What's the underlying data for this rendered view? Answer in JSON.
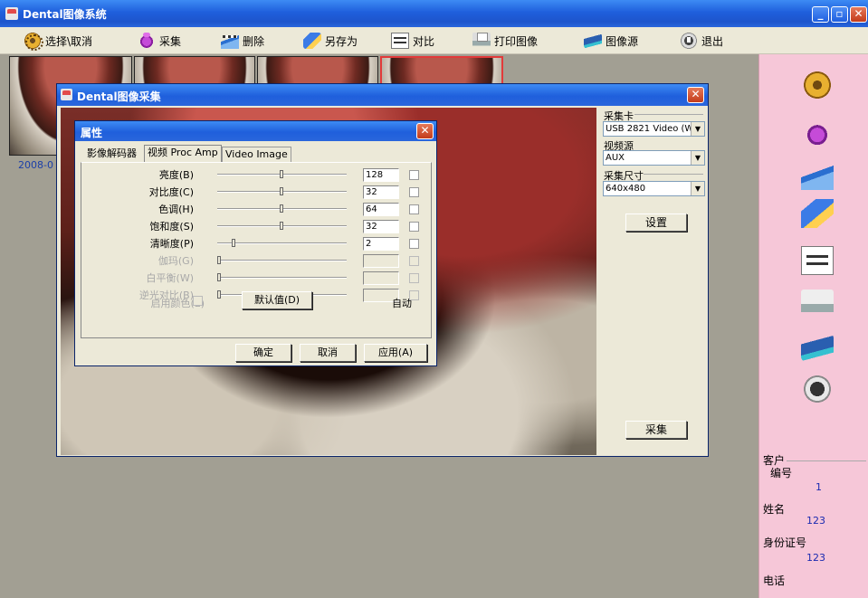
{
  "window": {
    "title": "Dental图像系统"
  },
  "toolbar": {
    "items": [
      {
        "label": "选择\\取消",
        "icon": "film-reel-icon"
      },
      {
        "label": "采集",
        "icon": "capture-icon"
      },
      {
        "label": "删除",
        "icon": "clapper-icon"
      },
      {
        "label": "另存为",
        "icon": "save-disk-icon"
      },
      {
        "label": "对比",
        "icon": "compare-icon"
      },
      {
        "label": "打印图像",
        "icon": "printer-icon"
      },
      {
        "label": "图像源",
        "icon": "scanner-icon"
      },
      {
        "label": "退出",
        "icon": "exit-icon"
      }
    ]
  },
  "thumbnails": {
    "date_label": "2008-0"
  },
  "capture_dialog": {
    "title": "Dental图像采集",
    "card_label": "采集卡",
    "card_value": "USB 2821 Video (W",
    "source_label": "视频源",
    "source_value": "AUX",
    "size_label": "采集尺寸",
    "size_value": "640x480",
    "settings_button": "设置",
    "capture_button": "采集"
  },
  "properties_dialog": {
    "title": "属性",
    "tabs": [
      "影像解码器",
      "视频 Proc Amp",
      "Video Image"
    ],
    "rows": [
      {
        "label": "亮度(B)",
        "value": "128",
        "enabled": true,
        "pos": 0.5
      },
      {
        "label": "对比度(C)",
        "value": "32",
        "enabled": true,
        "pos": 0.5
      },
      {
        "label": "色调(H)",
        "value": "64",
        "enabled": true,
        "pos": 0.5
      },
      {
        "label": "饱和度(S)",
        "value": "32",
        "enabled": true,
        "pos": 0.5
      },
      {
        "label": "清晰度(P)",
        "value": "2",
        "enabled": true,
        "pos": 0.12
      },
      {
        "label": "伽玛(G)",
        "value": "",
        "enabled": false,
        "pos": 0.0
      },
      {
        "label": "白平衡(W)",
        "value": "",
        "enabled": false,
        "pos": 0.0
      },
      {
        "label": "逆光对比(B)",
        "value": "",
        "enabled": false,
        "pos": 0.0
      }
    ],
    "color_enable_label": "启用颜色(E)",
    "default_button": "默认值(D)",
    "auto_label": "自动",
    "ok_button": "确定",
    "cancel_button": "取消",
    "apply_button": "应用(A)"
  },
  "client": {
    "group_label": "客户",
    "id_label": "编号",
    "id_value": "1",
    "name_label": "姓名",
    "name_value": "123",
    "idcard_label": "身份证号",
    "idcard_value": "123",
    "phone_label": "电话"
  }
}
